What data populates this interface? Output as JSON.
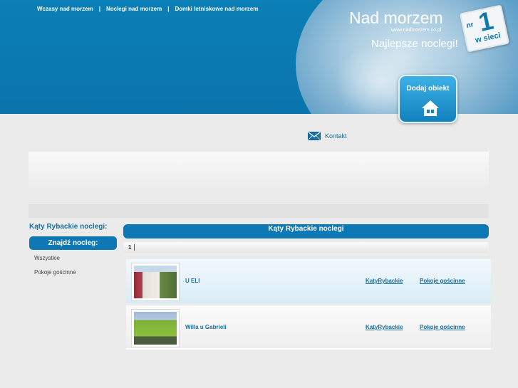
{
  "header": {
    "nav": [
      "Wczasy nad morzem",
      "Noclegi nad morzem",
      "Domki letniskowe nad morzem"
    ],
    "separator": "|",
    "brand": "Nad morzem",
    "brand_url": "www.nadmorzem.co.pl",
    "tagline": "Najlepsze noclegi!",
    "badge": {
      "nr": "nr",
      "number": "1",
      "text": "w sieci"
    },
    "add_button": "Dodaj obiekt"
  },
  "contact": {
    "label": "Kontakt",
    "icon": "envelope-icon"
  },
  "sidebar": {
    "title": "Kąty Rybackie noclegi:",
    "find_button": "Znajdź nocleg:",
    "items": [
      "Wszystkie",
      "Pokoje gościnne"
    ]
  },
  "main": {
    "title": "Kąty Rybackie noclegi",
    "pager": {
      "current": "1"
    },
    "listings": [
      {
        "name": "U ELI",
        "city": "KatyRybackie",
        "type": "Pokoje gościnne"
      },
      {
        "name": "Willa u Gabrieli",
        "city": "KatyRybackie",
        "type": "Pokoje gościnne"
      }
    ]
  },
  "colors": {
    "brand_blue": "#0b7fb7",
    "accent_blue": "#0d78b3",
    "link": "#1b6f9f",
    "background": "#ebebeb"
  }
}
